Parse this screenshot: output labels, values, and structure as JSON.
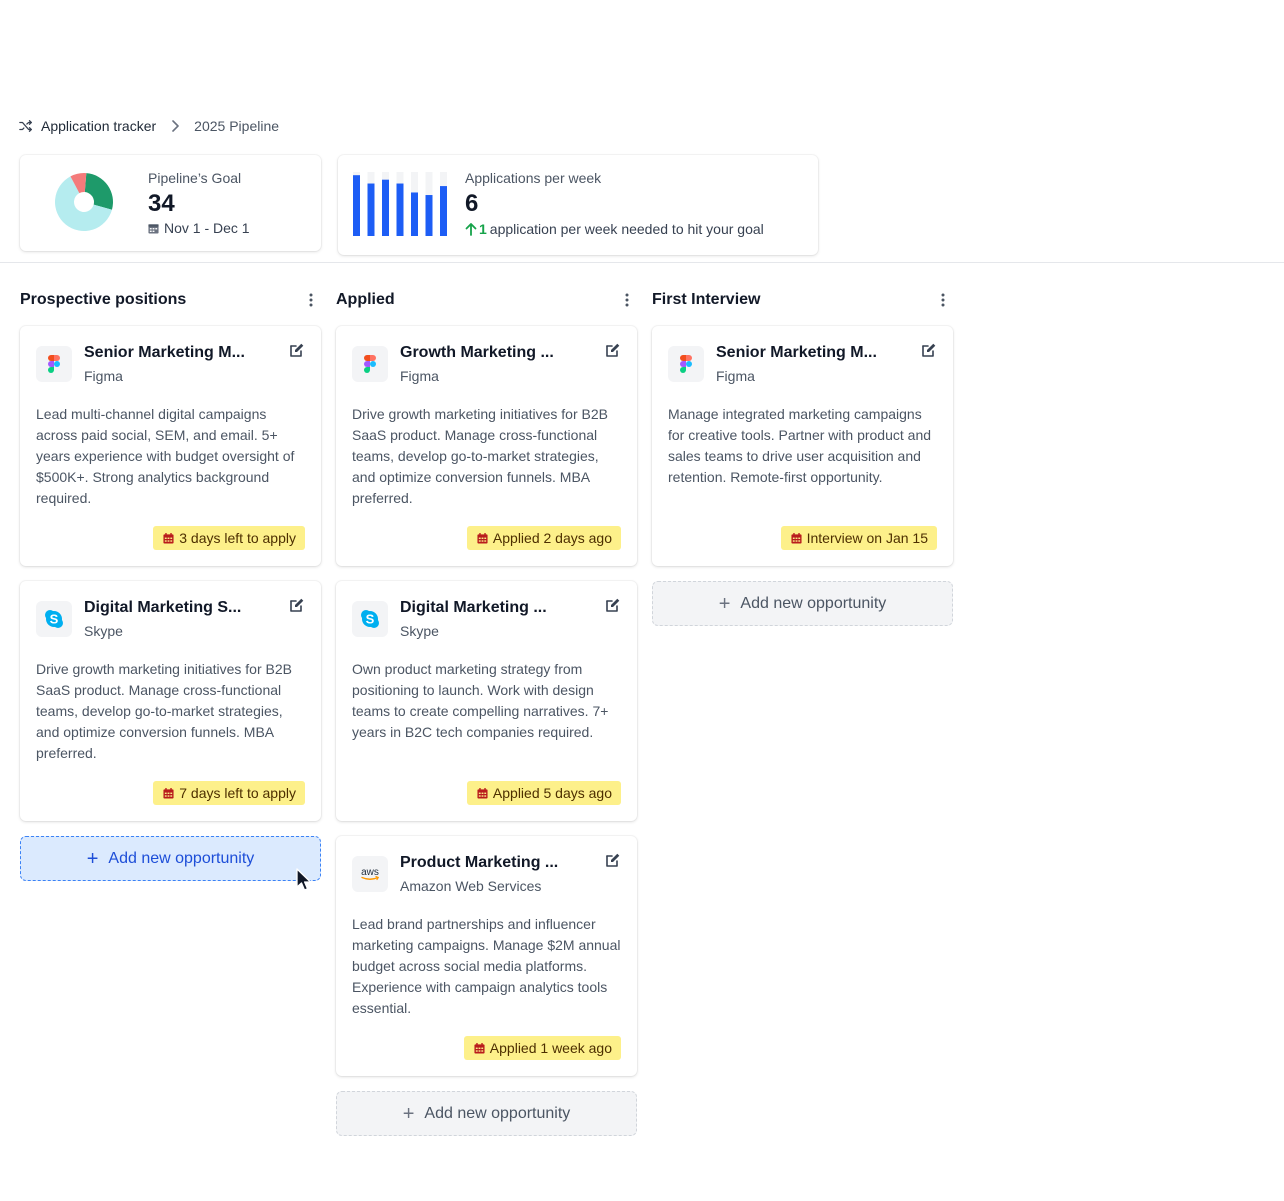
{
  "breadcrumb": {
    "root": "Application tracker",
    "current": "2025 Pipeline"
  },
  "stats": {
    "goal": {
      "label": "Pipeline’s Goal",
      "value": "34",
      "range": "Nov 1 - Dec 1",
      "donut_segments": [
        {
          "name": "teal",
          "fraction": 0.63,
          "color": "#b5ecef"
        },
        {
          "name": "green",
          "fraction": 0.28,
          "color": "#1e9a6a"
        },
        {
          "name": "red",
          "fraction": 0.09,
          "color": "#f47b7b"
        }
      ]
    },
    "weekly": {
      "label": "Applications per week",
      "value": "6",
      "delta": "1",
      "delta_text": "application per week needed to hit your goal",
      "bar_fill_fractions": [
        0.95,
        0.82,
        0.88,
        0.82,
        0.68,
        0.64,
        0.78
      ],
      "bar_color": "#1d5df5",
      "track_color": "#f3f4f6"
    }
  },
  "columns": [
    {
      "title": "Prospective positions",
      "add_label": "Add new opportunity",
      "cards": [
        {
          "logo": "figma-logo",
          "title": "Senior Marketing M...",
          "company": "Figma",
          "description": "Lead multi-channel digital campaigns across paid social, SEM, and email. 5+ years experience with budget oversight of $500K+. Strong analytics background required.",
          "badge": "3 days left to apply"
        },
        {
          "logo": "skype-logo",
          "title": "Digital Marketing S...",
          "company": "Skype",
          "description": "Drive growth marketing initiatives for B2B SaaS product. Manage cross-functional teams, develop go-to-market strategies, and optimize conversion funnels. MBA preferred.",
          "badge": "7 days left to apply"
        }
      ]
    },
    {
      "title": "Applied",
      "add_label": "Add new opportunity",
      "cards": [
        {
          "logo": "figma-logo",
          "title": "Growth Marketing ...",
          "company": "Figma",
          "description": "Drive growth marketing initiatives for B2B SaaS product. Manage cross-functional teams, develop go-to-market strategies, and optimize conversion funnels. MBA preferred.",
          "badge": "Applied 2 days ago"
        },
        {
          "logo": "skype-logo",
          "title": "Digital Marketing ...",
          "company": "Skype",
          "description": "Own product marketing strategy from positioning to launch. Work with design teams to create compelling narratives. 7+ years in B2C tech companies required.",
          "badge": "Applied 5 days ago"
        },
        {
          "logo": "aws-logo",
          "logo_text": "aws",
          "title": "Product Marketing ...",
          "company": "Amazon Web Services",
          "description": "Lead brand partnerships and influencer marketing campaigns. Manage $2M annual budget across social media platforms. Experience with campaign analytics tools essential.",
          "badge": "Applied 1 week ago"
        }
      ]
    },
    {
      "title": "First Interview",
      "add_label": "Add new opportunity",
      "cards": [
        {
          "logo": "figma-logo",
          "title": "Senior Marketing M...",
          "company": "Figma",
          "description": "Manage integrated marketing campaigns for creative tools. Partner with product and sales teams to drive user acquisition and retention. Remote-first opportunity.",
          "badge": "Interview on Jan 15"
        }
      ]
    }
  ],
  "colors": {
    "badge_bg": "#fdf08a",
    "badge_text": "#4d2f00",
    "calendar_icon": "#b91c1c",
    "active_add_bg": "#dbeafe",
    "active_add_text": "#1d4ed8"
  }
}
